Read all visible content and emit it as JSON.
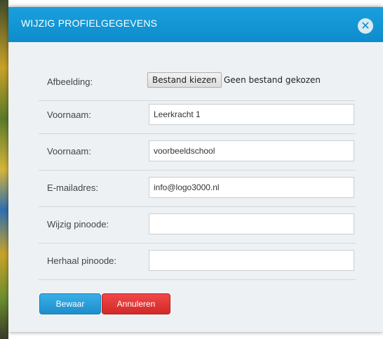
{
  "dialog": {
    "title": "Wijzig profielgegevens",
    "close_symbol": "✕"
  },
  "form": {
    "image": {
      "label": "Afbeelding:",
      "button_label": "Bestand kiezen",
      "status": "Geen bestand gekozen"
    },
    "first_name": {
      "label": "Voornaam:",
      "value": "Leerkracht 1"
    },
    "last_name": {
      "label": "Voornaam:",
      "value": "voorbeeldschool"
    },
    "email": {
      "label": "E-mailadres:",
      "value": "info@logo3000.nl"
    },
    "pin": {
      "label": "Wijzig pinoode:",
      "value": ""
    },
    "pin_repeat": {
      "label": "Herhaal pinoode:",
      "value": ""
    }
  },
  "actions": {
    "save_label": "Bewaar",
    "cancel_label": "Annuleren"
  },
  "colors": {
    "titlebar": "#0d8ccc",
    "save": "#1d8fcc",
    "cancel": "#d22828"
  }
}
